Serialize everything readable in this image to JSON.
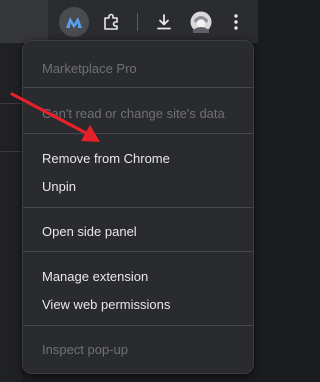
{
  "toolbar": {
    "extension_icon": "marketplace-pro-logo-icon",
    "extensions_icon": "puzzle-piece-icon",
    "download_icon": "download-icon",
    "profile_icon": "profile-avatar",
    "menu_icon": "vertical-dots-icon"
  },
  "menu": {
    "title": "Marketplace Pro",
    "site_data": "Can't read or change site's data",
    "remove": "Remove from Chrome",
    "unpin": "Unpin",
    "side_panel": "Open side panel",
    "manage": "Manage extension",
    "permissions": "View web permissions",
    "inspect": "Inspect pop-up"
  },
  "annotation": {
    "color": "#e8202a"
  }
}
